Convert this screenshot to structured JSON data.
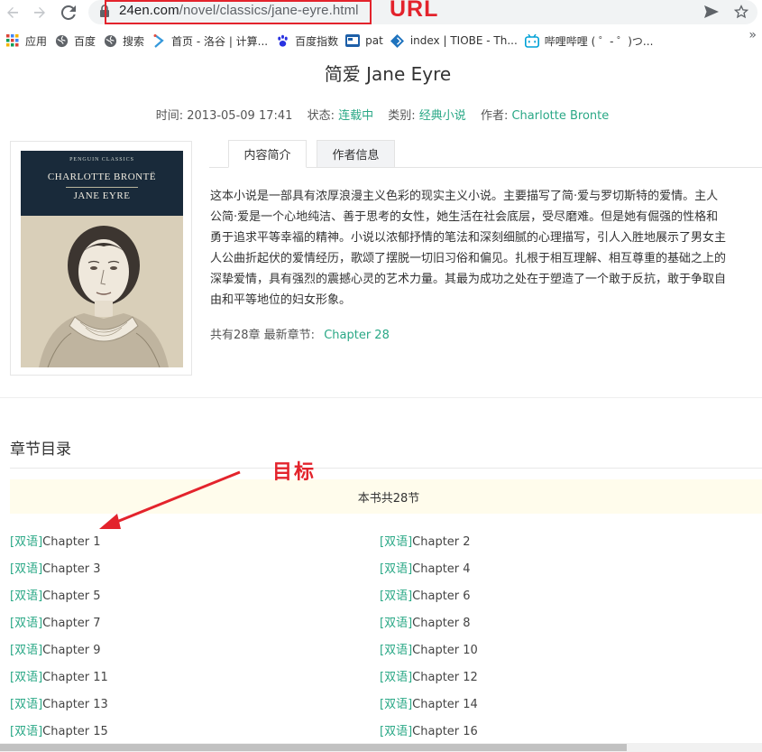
{
  "browser": {
    "url_host": "24en.com",
    "url_path": "/novel/classics/jane-eyre.html",
    "bookmarks": [
      {
        "label": "应用",
        "icon": "apps-grid-icon"
      },
      {
        "label": "百度",
        "icon": "globe-icon"
      },
      {
        "label": "搜索",
        "icon": "globe-icon"
      },
      {
        "label": "首页 - 洛谷 | 计算...",
        "icon": "luogu-icon"
      },
      {
        "label": "百度指数",
        "icon": "baidu-paw-icon"
      },
      {
        "label": "pat",
        "icon": "pat-icon"
      },
      {
        "label": "index | TIOBE - Th...",
        "icon": "tiobe-icon"
      },
      {
        "label": "哔哩哔哩 ( ゜- ゜)つ...",
        "icon": "bilibili-icon"
      }
    ]
  },
  "annotations": {
    "url_label": "URL",
    "target_label": "目标",
    "color": "#e3232c"
  },
  "book": {
    "title": "简爱 Jane Eyre",
    "time_label": "时间:",
    "time_value": "2013-05-09 17:41",
    "status_label": "状态:",
    "status_value": "连载中",
    "category_label": "类别:",
    "category_value": "经典小说",
    "author_label": "作者:",
    "author_value": "Charlotte Bronte",
    "cover": {
      "publisher": "PENGUIN CLASSICS",
      "author": "CHARLOTTE BRONTË",
      "title": "JANE EYRE"
    },
    "tabs": [
      "内容简介",
      "作者信息"
    ],
    "description_lines": [
      "这本小说是一部具有浓厚浪漫主义色彩的现实主义小说。主要描写了简·爱与罗切斯特的爱情。主人",
      "公简·爱是一个心地纯洁、善于思考的女性，她生活在社会底层，受尽磨难。但是她有倔强的性格和",
      "勇于追求平等幸福的精神。小说以浓郁抒情的笔法和深刻细腻的心理描写，引人入胜地展示了男女主",
      "人公曲折起伏的爱情经历，歌颂了摆脱一切旧习俗和偏见。扎根于相互理解、相互尊重的基础之上的",
      "深挚爱情，具有强烈的震撼心灵的艺术力量。其最为成功之处在于塑造了一个敢于反抗，敢于争取自",
      "由和平等地位的妇女形象。"
    ],
    "latest_prefix": "共有28章 最新章节:",
    "latest_chapter": "Chapter 28"
  },
  "chapters_section": {
    "title": "章节目录",
    "count_banner": "本书共28节",
    "tag": "[双语]",
    "items": [
      "Chapter 1",
      "Chapter 2",
      "Chapter 3",
      "Chapter 4",
      "Chapter 5",
      "Chapter 6",
      "Chapter 7",
      "Chapter 8",
      "Chapter 9",
      "Chapter 10",
      "Chapter 11",
      "Chapter 12",
      "Chapter 13",
      "Chapter 14",
      "Chapter 15",
      "Chapter 16"
    ]
  },
  "colors": {
    "link": "#2aa886",
    "banner_bg": "#fffcec"
  }
}
